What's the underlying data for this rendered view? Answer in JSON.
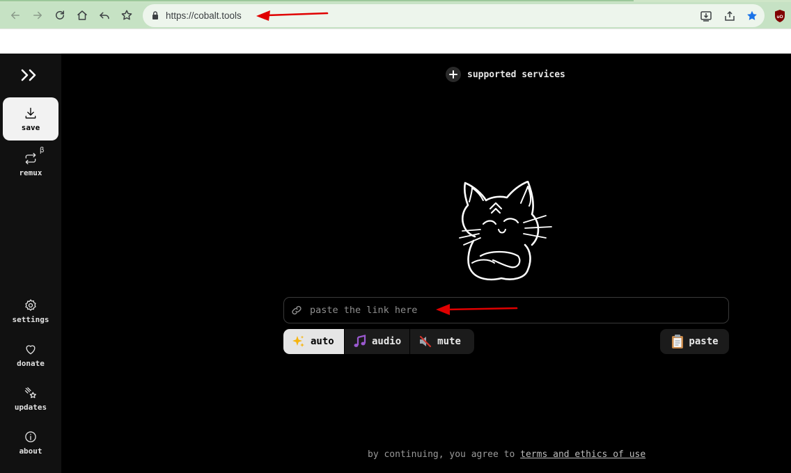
{
  "browser": {
    "url": "https://cobalt.tools",
    "colors": {
      "toolbar": "#c6e2c4",
      "omnibox": "#edf5ec"
    }
  },
  "sidebar": {
    "logo_icon": "cobalt-logo-icon",
    "items": [
      {
        "id": "save",
        "label": "save",
        "icon": "download-icon",
        "active": true
      },
      {
        "id": "remux",
        "label": "remux",
        "icon": "remux-icon",
        "badge": "β"
      },
      {
        "id": "settings",
        "label": "settings",
        "icon": "gear-icon"
      },
      {
        "id": "donate",
        "label": "donate",
        "icon": "heart-icon"
      },
      {
        "id": "updates",
        "label": "updates",
        "icon": "stars-icon"
      },
      {
        "id": "about",
        "label": "about",
        "icon": "info-icon"
      }
    ]
  },
  "main": {
    "supported_services": "supported services",
    "link_input": {
      "placeholder": "paste the link here"
    },
    "modes": [
      {
        "label": "auto",
        "icon": "sparkles-icon",
        "active": true
      },
      {
        "label": "audio",
        "icon": "music-notes-icon"
      },
      {
        "label": "mute",
        "icon": "muted-speaker-icon"
      }
    ],
    "paste_label": "paste",
    "footer": {
      "prefix": "by continuing, you agree to",
      "link": "terms and ethics of use"
    }
  },
  "colors": {
    "page_bg": "#000000",
    "sidebar_bg": "#111111",
    "annotation_arrow": "#e00000"
  }
}
